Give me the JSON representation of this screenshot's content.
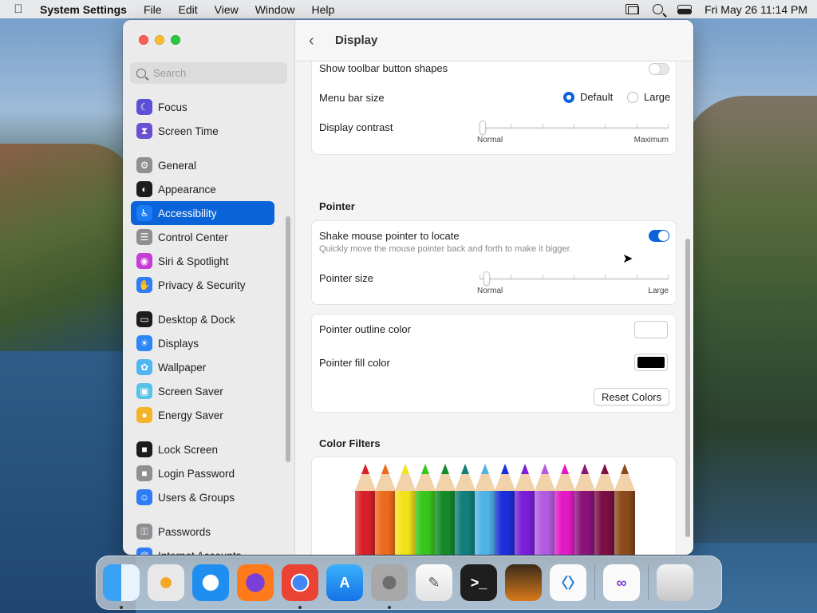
{
  "menubar": {
    "app_name": "System Settings",
    "menus": [
      "File",
      "Edit",
      "View",
      "Window",
      "Help"
    ],
    "clock": "Fri May 26  11:14 PM"
  },
  "sidebar": {
    "search_placeholder": "Search",
    "groups": [
      [
        {
          "label": "Focus",
          "icon": "moon-icon",
          "color": "#5b4fd6"
        },
        {
          "label": "Screen Time",
          "icon": "hourglass-icon",
          "color": "#6a4fd0"
        }
      ],
      [
        {
          "label": "General",
          "icon": "gear-icon",
          "color": "#8e8e93"
        },
        {
          "label": "Appearance",
          "icon": "appearance-icon",
          "color": "#1c1c1e"
        },
        {
          "label": "Accessibility",
          "icon": "accessibility-icon",
          "color": "#1a7cf5",
          "active": true
        },
        {
          "label": "Control Center",
          "icon": "control-center-icon",
          "color": "#8e8e93"
        },
        {
          "label": "Siri & Spotlight",
          "icon": "siri-icon",
          "color": "#c53dd6"
        },
        {
          "label": "Privacy & Security",
          "icon": "hand-icon",
          "color": "#2f7cf6"
        }
      ],
      [
        {
          "label": "Desktop & Dock",
          "icon": "dock-icon",
          "color": "#1c1c1e"
        },
        {
          "label": "Displays",
          "icon": "sun-icon",
          "color": "#2d86f7"
        },
        {
          "label": "Wallpaper",
          "icon": "flower-icon",
          "color": "#4fb6f2"
        },
        {
          "label": "Screen Saver",
          "icon": "screensaver-icon",
          "color": "#55c2e8"
        },
        {
          "label": "Energy Saver",
          "icon": "bulb-icon",
          "color": "#f5b32a"
        }
      ],
      [
        {
          "label": "Lock Screen",
          "icon": "lock-icon",
          "color": "#1c1c1e"
        },
        {
          "label": "Login Password",
          "icon": "padlock-icon",
          "color": "#8e8e93"
        },
        {
          "label": "Users & Groups",
          "icon": "users-icon",
          "color": "#2f7cf6"
        }
      ],
      [
        {
          "label": "Passwords",
          "icon": "key-icon",
          "color": "#8e8e93"
        },
        {
          "label": "Internet Accounts",
          "icon": "at-icon",
          "color": "#2f7cf6"
        }
      ]
    ]
  },
  "content": {
    "title": "Display",
    "display": {
      "toolbar_shapes_label": "Show toolbar button shapes",
      "toolbar_shapes_on": false,
      "menu_bar_size_label": "Menu bar size",
      "menu_bar_options": [
        "Default",
        "Large"
      ],
      "menu_bar_selected": "Default",
      "contrast_label": "Display contrast",
      "contrast_min_label": "Normal",
      "contrast_max_label": "Maximum",
      "contrast_value": 0
    },
    "pointer": {
      "section_title": "Pointer",
      "shake_label": "Shake mouse pointer to locate",
      "shake_desc": "Quickly move the mouse pointer back and forth to make it bigger.",
      "shake_on": true,
      "size_label": "Pointer size",
      "size_min_label": "Normal",
      "size_max_label": "Large",
      "size_value": 0.02,
      "outline_label": "Pointer outline color",
      "outline_color": "#ffffff",
      "fill_label": "Pointer fill color",
      "fill_color": "#000000",
      "reset_label": "Reset Colors"
    },
    "color_filters": {
      "section_title": "Color Filters",
      "pencil_colors": [
        "#d8202a",
        "#ec6a1d",
        "#f2e21a",
        "#39c61c",
        "#148a2b",
        "#117f7a",
        "#4fb3e6",
        "#1a2fd8",
        "#7a1fd6",
        "#b35be0",
        "#e21ac5",
        "#8a137a",
        "#7a0f44",
        "#8b4a1b"
      ]
    }
  },
  "dock": {
    "apps": [
      {
        "name": "Finder",
        "icon": "finder-icon",
        "running": true
      },
      {
        "name": "Launchpad",
        "icon": "launchpad-icon",
        "running": false
      },
      {
        "name": "Safari",
        "icon": "safari-icon",
        "running": false
      },
      {
        "name": "Firefox",
        "icon": "firefox-icon",
        "running": false
      },
      {
        "name": "Chrome",
        "icon": "chrome-icon",
        "running": true
      },
      {
        "name": "App Store",
        "icon": "appstore-icon",
        "running": false
      },
      {
        "name": "System Settings",
        "icon": "settings-icon",
        "running": true
      },
      {
        "name": "TextEdit",
        "icon": "textedit-icon",
        "running": false
      },
      {
        "name": "Terminal",
        "icon": "terminal-icon",
        "running": false
      },
      {
        "name": "GarageBand",
        "icon": "garageband-icon",
        "running": false
      },
      {
        "name": "Visual Studio Code",
        "icon": "vscode-icon",
        "running": false
      }
    ],
    "recent": [
      {
        "name": "Visual Studio",
        "icon": "visualstudio-icon",
        "running": false
      }
    ],
    "trash": {
      "name": "Trash",
      "icon": "trash-icon"
    }
  }
}
